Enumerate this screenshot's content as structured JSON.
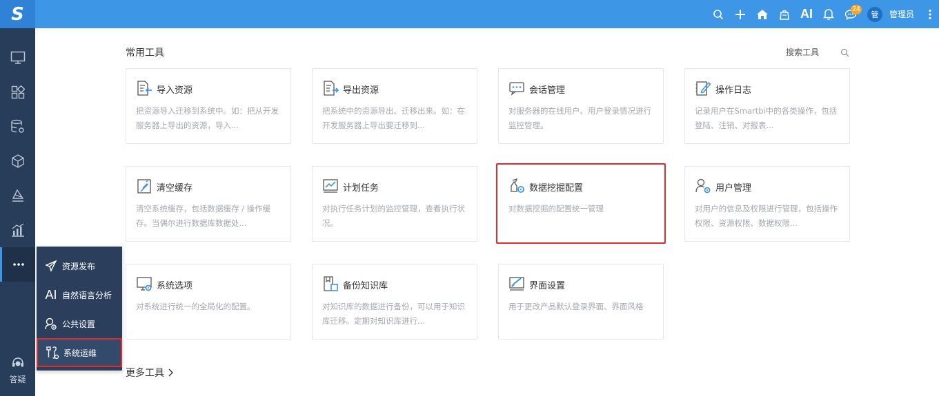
{
  "app": {
    "logo_text": "S"
  },
  "topbar": {
    "ai_label": "AI",
    "notification_count": "24",
    "avatar_text": "管",
    "username": "管理员",
    "icons": [
      "search-icon",
      "plus-icon",
      "home-icon",
      "bag-icon",
      "ai-icon",
      "bell-icon",
      "chat-icon",
      "more-icon"
    ]
  },
  "sidebar": {
    "items": [
      "monitor-icon",
      "apps-icon",
      "database-icon",
      "cube-icon",
      "layers-icon",
      "bar-chart-icon",
      "more-dots-icon"
    ],
    "help_label": "答疑"
  },
  "flyout": {
    "items": [
      {
        "label": "资源发布",
        "icon": "send-icon"
      },
      {
        "label": "自然语言分析",
        "icon": "ai-icon",
        "icon_text": "AI"
      },
      {
        "label": "公共设置",
        "icon": "settings-icon"
      },
      {
        "label": "系统运维",
        "icon": "tools-icon"
      }
    ]
  },
  "main": {
    "section_title": "常用工具",
    "search_label": "搜索工具",
    "more_tools": "更多工具",
    "cards": [
      {
        "title": "导入资源",
        "desc": "把资源导入迁移到系统中。如：把从开发服务器上导出的资源，导入...",
        "icon": "import-icon"
      },
      {
        "title": "导出资源",
        "desc": "把系统中的资源导出、迁移出来。如：在开发服务器上导出要迁移到...",
        "icon": "export-icon"
      },
      {
        "title": "会话管理",
        "desc": "对服务器的在线用户、用户登录情况进行监控管理。",
        "icon": "session-icon"
      },
      {
        "title": "操作日志",
        "desc": "记录用户在Smartbi中的各类操作，包括登陆、注销、对报表...",
        "icon": "log-icon"
      },
      {
        "title": "清空缓存",
        "desc": "清空系统缓存，包括数据缓存 / 操作缓存。当偶尔进行数据库数据处...",
        "icon": "clear-cache-icon"
      },
      {
        "title": "计划任务",
        "desc": "对执行任务计划的监控管理，查看执行状况。",
        "icon": "schedule-icon"
      },
      {
        "title": "数据挖掘配置",
        "desc": "对数据挖掘的配置统一管理",
        "icon": "mining-config-icon"
      },
      {
        "title": "用户管理",
        "desc": "对用户的信息及权限进行管理，包括操作权限、资源权限、数据权限...",
        "icon": "user-manage-icon"
      },
      {
        "title": "系统选项",
        "desc": "对系统进行统一的全局化的配置。",
        "icon": "system-options-icon"
      },
      {
        "title": "备份知识库",
        "desc": "对知识库的数据进行备份，可以用于知识库迁移。定期对知识库进行...",
        "icon": "backup-icon"
      },
      {
        "title": "界面设置",
        "desc": "用于更改产品默认登录界面、界面风格",
        "icon": "ui-settings-icon"
      }
    ]
  },
  "colors": {
    "topbar": "#3e96e6",
    "sidebar": "#283d59",
    "highlight": "#e22b2b",
    "icon_blue": "#3e96e6"
  }
}
